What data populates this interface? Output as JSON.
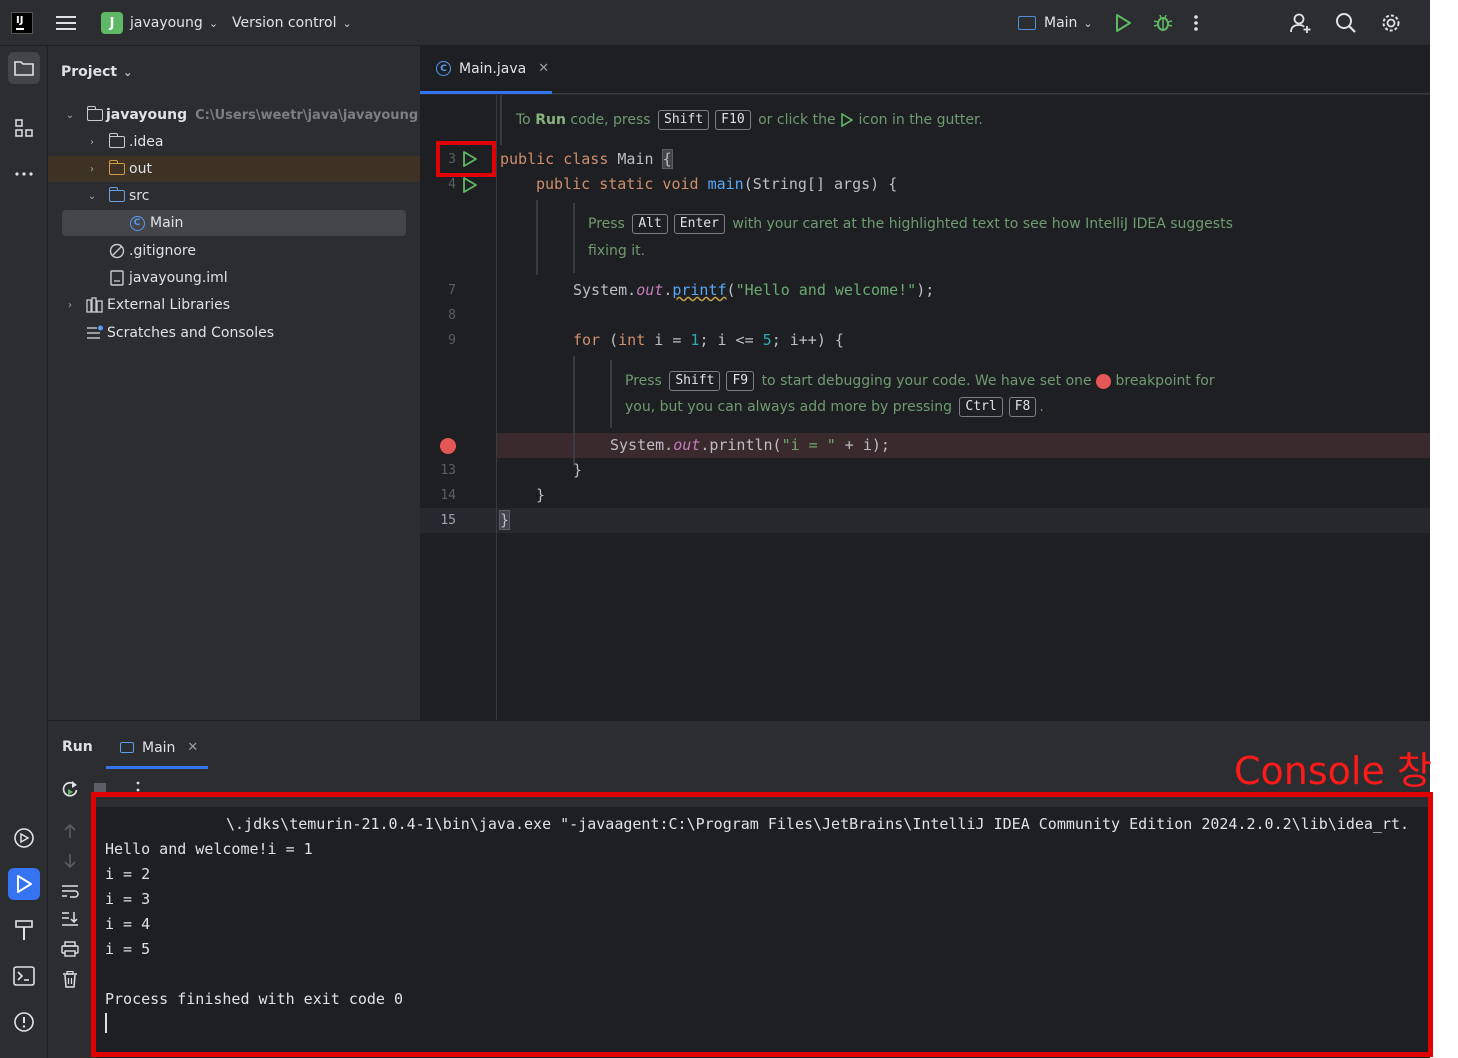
{
  "titlebar": {
    "project_badge": "J",
    "project_name": "javayoung",
    "vcs_label": "Version control",
    "run_config": "Main"
  },
  "project_panel": {
    "title": "Project",
    "root": {
      "name": "javayoung",
      "path": "C:\\Users\\weetr\\java\\javayoung"
    },
    "items": [
      {
        "label": ".idea"
      },
      {
        "label": "out"
      },
      {
        "label": "src"
      },
      {
        "label": "Main"
      },
      {
        "label": ".gitignore"
      },
      {
        "label": "javayoung.iml"
      },
      {
        "label": "External Libraries"
      },
      {
        "label": "Scratches and Consoles"
      }
    ]
  },
  "editor": {
    "tab_label": "Main.java",
    "hint_run": {
      "pre": "To",
      "run_word": "Run",
      "mid": "code, press",
      "key1": "Shift",
      "key2": "F10",
      "post1": "or click the",
      "post2": "icon in the gutter."
    },
    "hint_alt": {
      "pre": "Press",
      "key1": "Alt",
      "key2": "Enter",
      "post": "with your caret at the highlighted text to see how IntelliJ IDEA suggests",
      "line2": "fixing it."
    },
    "hint_debug": {
      "pre": "Press",
      "key1": "Shift",
      "key2": "F9",
      "post1": "to start debugging your code. We have set one",
      "post2": "breakpoint for",
      "line2": "you, but you can always add more by pressing",
      "key3": "Ctrl",
      "key4": "F8",
      "end": "."
    },
    "line_numbers": [
      "3",
      "4",
      "7",
      "8",
      "9",
      "13",
      "14",
      "15"
    ],
    "code": {
      "l3_kw": "public class",
      "l3_name": "Main",
      "l3_brace": "{",
      "l4_kw": "public static void",
      "l4_fn": "main",
      "l4_args": "(String[] args) {",
      "l7_pre": "System.",
      "l7_field": "out",
      "l7_dot": ".",
      "l7_fn": "printf",
      "l7_open": "(",
      "l7_str": "\"Hello and welcome!\"",
      "l7_close": ");",
      "l9_kw": "for",
      "l9_a": " (",
      "l9_kw2": "int",
      "l9_b": " i = ",
      "l9_n1": "1",
      "l9_c": "; i <= ",
      "l9_n2": "5",
      "l9_d": "; i++) {",
      "l12_pre": "System.",
      "l12_field": "out",
      "l12_mid": ".println(",
      "l12_str": "\"i = \"",
      "l12_end": " + i);",
      "l13": "}",
      "l14": "}",
      "l15": "}"
    }
  },
  "run_window": {
    "title": "Run",
    "tab_label": "Main",
    "console_lines": [
      "\\.jdks\\temurin-21.0.4-1\\bin\\java.exe \"-javaagent:C:\\Program Files\\JetBrains\\IntelliJ IDEA Community Edition 2024.2.0.2\\lib\\idea_rt.",
      "Hello and welcome!i = 1",
      "i = 2",
      "i = 3",
      "i = 4",
      "i = 5",
      "",
      "Process finished with exit code 0"
    ]
  },
  "annotation": {
    "caption": "Console 창"
  },
  "colors": {
    "highlight": "#e00000",
    "accent": "#3574f0",
    "run_green": "#5fb865",
    "breakpoint": "#e55757"
  }
}
